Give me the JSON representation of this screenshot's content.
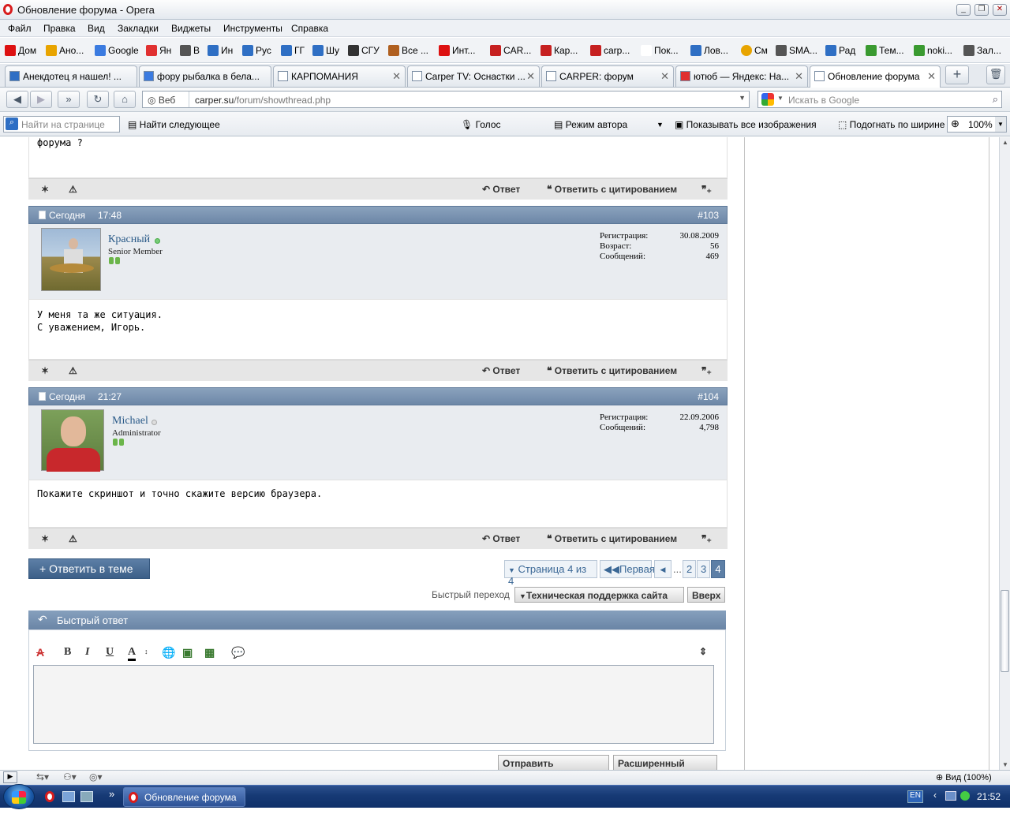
{
  "window": {
    "title": "Обновление форума - Opera"
  },
  "menu": [
    "Файл",
    "Правка",
    "Вид",
    "Закладки",
    "Виджеты",
    "Инструменты",
    "Справка"
  ],
  "bookmarks": [
    {
      "label": "Дом",
      "color": "#d11"
    },
    {
      "label": "Ано...",
      "color": "#e8a400"
    },
    {
      "label": "Google",
      "color": "#3b7be0"
    },
    {
      "label": "Ян",
      "color": "#e03030"
    },
    {
      "label": "В",
      "color": "#555"
    },
    {
      "label": "Ин",
      "color": "#2f6fc4"
    },
    {
      "label": "Рус",
      "color": "#2f6fc4"
    },
    {
      "label": "ГГ",
      "color": "#2f6fc4"
    },
    {
      "label": "Шу",
      "color": "#2f6fc4"
    },
    {
      "label": "СГУ",
      "color": "#333"
    },
    {
      "label": "Все ...",
      "color": "#b06020"
    },
    {
      "label": "Инт...",
      "color": "#d11"
    },
    {
      "label": "CAR...",
      "color": "#c62020"
    },
    {
      "label": "Кар...",
      "color": "#c62020"
    },
    {
      "label": "carp...",
      "color": "#c62020"
    },
    {
      "label": "Пок...",
      "color": "#ffffff"
    },
    {
      "label": "Лов...",
      "color": "#2f6fc4"
    },
    {
      "label": "См",
      "color": "#e8a400"
    },
    {
      "label": "SMA...",
      "color": "#555"
    },
    {
      "label": "Рад",
      "color": "#2f6fc4"
    },
    {
      "label": "Тем...",
      "color": "#3a9a30"
    },
    {
      "label": "noki...",
      "color": "#3a9a30"
    },
    {
      "label": "Зал...",
      "color": "#555"
    }
  ],
  "tabs": [
    {
      "label": "Анекдотец я нашел! ...",
      "active": false
    },
    {
      "label": "фору рыбалка в бела...",
      "active": false
    },
    {
      "label": "КАРПОМАНИЯ",
      "active": false
    },
    {
      "label": "Carper TV: Оснастки ...",
      "active": false
    },
    {
      "label": "CARPER: форум",
      "active": false
    },
    {
      "label": "ютюб — Яндекс: На...",
      "active": false
    },
    {
      "label": "Обновление форума",
      "active": true
    }
  ],
  "address": {
    "engine": "Веб",
    "url_host": "carper.su",
    "url_path": "/forum/showthread.php",
    "search_placeholder": "Искать в Google"
  },
  "findbar": {
    "placeholder": "Найти на странице",
    "find_next": "Найти следующее",
    "voice": "Голос",
    "author_mode": "Режим автора",
    "show_images": "Показывать все изображения",
    "fit_width": "Подогнать по ширине",
    "zoom": "100%"
  },
  "prev_post": {
    "text": "форума ?"
  },
  "footer_labels": {
    "reply": "Ответ",
    "reply_quote": "Ответить с цитированием"
  },
  "posts": [
    {
      "date": "Сегодня",
      "time": "17:48",
      "num": "#103",
      "username": "Красный",
      "usertitle": "Senior Member",
      "online": true,
      "stats": [
        {
          "k": "Регистрация:",
          "v": "30.08.2009"
        },
        {
          "k": "Возраст:",
          "v": "56"
        },
        {
          "k": "Сообщений:",
          "v": "469"
        }
      ],
      "text": [
        "У меня та же ситуация.",
        "С уважением, Игорь."
      ]
    },
    {
      "date": "Сегодня",
      "time": "21:27",
      "num": "#104",
      "username": "Michael",
      "usertitle": "Administrator",
      "online": false,
      "stats": [
        {
          "k": "Регистрация:",
          "v": "22.09.2006"
        },
        {
          "k": "Сообщений:",
          "v": "4,798"
        }
      ],
      "text": [
        "Покажите скриншот и точно скажите версию браузера."
      ]
    }
  ],
  "thread_actions": {
    "reply_in_thread": "+ Ответить в теме",
    "pagination_label": "Страница 4 из 4",
    "first": "Первая",
    "pages": [
      "2",
      "3",
      "4"
    ],
    "ellipsis": "...",
    "quick_nav_label": "Быстрый переход",
    "quick_nav_value": "Техническая поддержка сайта",
    "top": "Вверх"
  },
  "quick_reply": {
    "title": "Быстрый ответ",
    "submit": "Отправить сообщение",
    "advanced": "Расширенный режим"
  },
  "statusbar": {
    "zoom": "Вид (100%)"
  },
  "taskbar": {
    "item": "Обновление форума ...",
    "lang": "EN",
    "time": "21:52"
  }
}
